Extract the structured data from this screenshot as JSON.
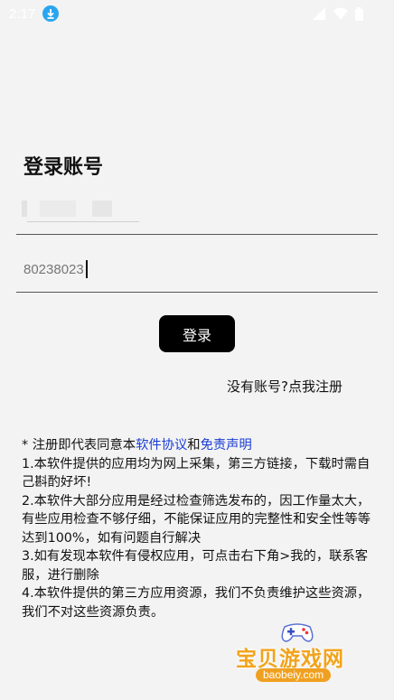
{
  "status_bar": {
    "time": "2:17",
    "icons": [
      "download-icon",
      "wifi-icon",
      "signal-icon",
      "battery-icon"
    ]
  },
  "login": {
    "title": "登录账号",
    "password_value": "80238023",
    "login_button": "登录",
    "register_link": "没有账号?点我注册"
  },
  "notice": {
    "prefix": "* 注册即代表同意本",
    "link_agreement": "软件协议",
    "and": "和",
    "link_disclaimer": "免责声明",
    "item1": "1.本软件提供的应用均为网上采集，第三方链接，下载时需自己斟酌好坏!",
    "item2": "2.本软件大部分应用是经过检查筛选发布的，因工作量太大，有些应用检查不够仔细，不能保证应用的完整性和安全性等等达到100%，如有问题自行解决",
    "item3": "3.如有发现本软件有侵权应用，可点击右下角>我的，联系客服，进行删除",
    "item4": "4.本软件提供的第三方应用资源，我们不负责维护这些资源，我们不对这些资源负责。"
  },
  "watermark": {
    "name": "宝贝游戏网",
    "url": "baobeiy.com"
  },
  "colors": {
    "background": "#f3f3f3",
    "button": "#000000",
    "link": "#1a3cd6",
    "download_badge": "#2aa6f0",
    "watermark": "#f2a31a"
  }
}
